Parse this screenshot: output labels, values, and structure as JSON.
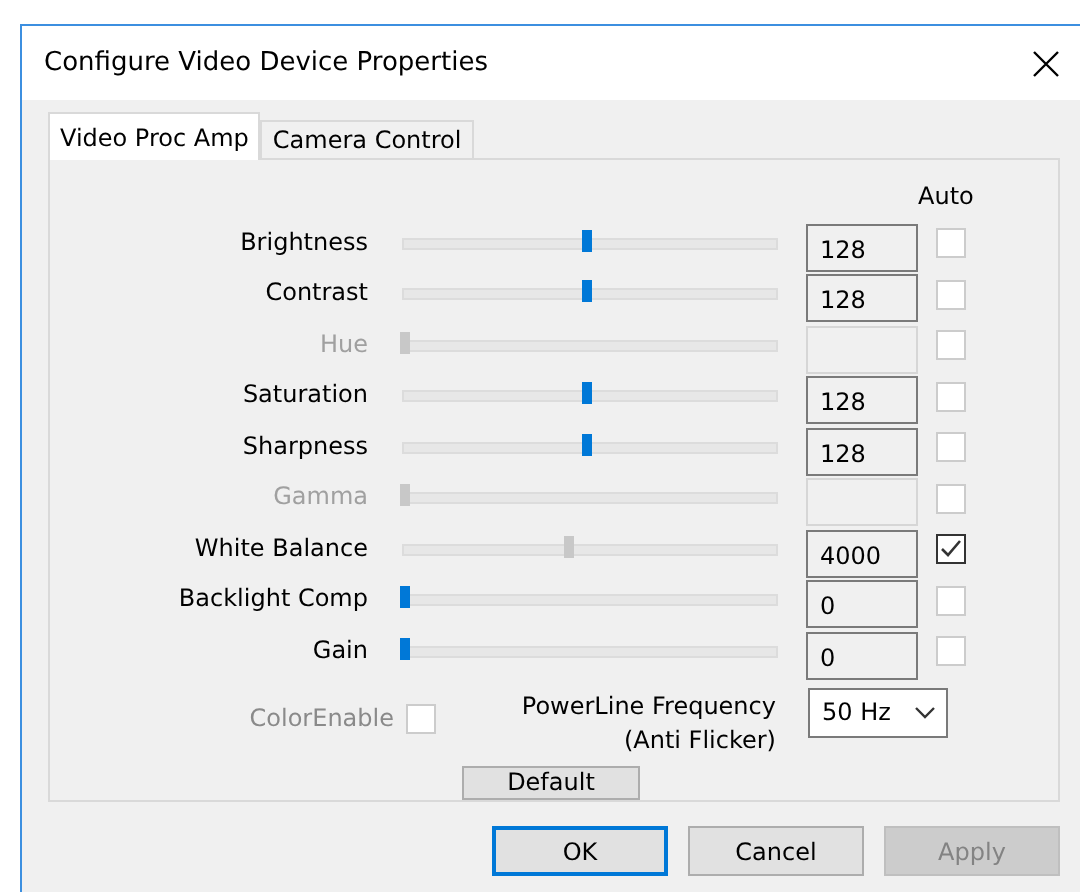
{
  "window": {
    "title": "Configure Video Device Properties"
  },
  "tabs": [
    {
      "label": "Video Proc Amp",
      "selected": true
    },
    {
      "label": "Camera Control",
      "selected": false
    }
  ],
  "auto_header": "Auto",
  "properties": [
    {
      "label": "Brightness",
      "disabled": false,
      "level": 0.49,
      "value": "128",
      "auto": false
    },
    {
      "label": "Contrast",
      "disabled": false,
      "level": 0.49,
      "value": "128",
      "auto": false
    },
    {
      "label": "Hue",
      "disabled": true,
      "level": 0,
      "auto": false
    },
    {
      "label": "Saturation",
      "disabled": false,
      "level": 0.49,
      "value": "128",
      "auto": false
    },
    {
      "label": "Sharpness",
      "disabled": false,
      "level": 0.49,
      "value": "128",
      "auto": false
    },
    {
      "label": "Gamma",
      "disabled": true,
      "level": 0,
      "auto": false
    },
    {
      "label": "White Balance",
      "disabled": false,
      "level": 0.44,
      "value": "4000",
      "auto": true
    },
    {
      "label": "Backlight Comp",
      "disabled": false,
      "level": 0,
      "value": "0",
      "auto": false
    },
    {
      "label": "Gain",
      "disabled": false,
      "level": 0,
      "value": "0",
      "auto": false
    }
  ],
  "color_enable": {
    "label": "ColorEnable",
    "disabled": true,
    "checked": false
  },
  "powerline": {
    "label": [
      "PowerLine Frequency",
      "(Anti Flicker)"
    ],
    "value": "50 Hz"
  },
  "default_button": "Default",
  "buttons": [
    {
      "label": "OK",
      "default": true,
      "disabled": false
    },
    {
      "label": "Cancel",
      "default": false,
      "disabled": false
    },
    {
      "label": "Apply",
      "default": false,
      "disabled": true
    }
  ]
}
